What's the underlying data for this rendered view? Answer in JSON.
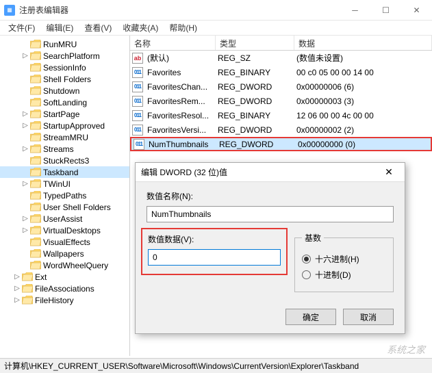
{
  "window": {
    "title": "注册表编辑器"
  },
  "menubar": [
    "文件(F)",
    "编辑(E)",
    "查看(V)",
    "收藏夹(A)",
    "帮助(H)"
  ],
  "tree": {
    "items": [
      "RunMRU",
      "SearchPlatform",
      "SessionInfo",
      "Shell Folders",
      "Shutdown",
      "SoftLanding",
      "StartPage",
      "StartupApproved",
      "StreamMRU",
      "Streams",
      "StuckRects3",
      "Taskband",
      "TWinUI",
      "TypedPaths",
      "User Shell Folders",
      "UserAssist",
      "VirtualDesktops",
      "VisualEffects",
      "Wallpapers",
      "WordWheelQuery",
      "Ext",
      "FileAssociations",
      "FileHistory"
    ],
    "selected": "Taskband",
    "expandable": [
      "SearchPlatform",
      "StartPage",
      "StartupApproved",
      "Streams",
      "TWinUI",
      "UserAssist",
      "VirtualDesktops",
      "Ext",
      "FileAssociations",
      "FileHistory"
    ],
    "indent2": [
      "Ext",
      "FileAssociations",
      "FileHistory"
    ]
  },
  "list": {
    "columns": {
      "name": "名称",
      "type": "类型",
      "data": "数据"
    },
    "rows": [
      {
        "icon": "ab",
        "name": "(默认)",
        "type": "REG_SZ",
        "data": "(数值未设置)"
      },
      {
        "icon": "num",
        "name": "Favorites",
        "type": "REG_BINARY",
        "data": "00 c0 05 00 00 14 00 "
      },
      {
        "icon": "num",
        "name": "FavoritesChan...",
        "type": "REG_DWORD",
        "data": "0x00000006 (6)"
      },
      {
        "icon": "num",
        "name": "FavoritesRem...",
        "type": "REG_DWORD",
        "data": "0x00000003 (3)"
      },
      {
        "icon": "num",
        "name": "FavoritesResol...",
        "type": "REG_BINARY",
        "data": "12 06 00 00 4c 00 00 "
      },
      {
        "icon": "num",
        "name": "FavoritesVersi...",
        "type": "REG_DWORD",
        "data": "0x00000002 (2)"
      },
      {
        "icon": "num",
        "name": "NumThumbnails",
        "type": "REG_DWORD",
        "data": "0x00000000 (0)",
        "highlighted": true,
        "selected": true
      }
    ]
  },
  "dialog": {
    "title": "编辑 DWORD (32 位)值",
    "name_label": "数值名称(N):",
    "name_value": "NumThumbnails",
    "data_label": "数值数据(V):",
    "data_value": "0",
    "base_label": "基数",
    "radio_hex": "十六进制(H)",
    "radio_dec": "十进制(D)",
    "ok": "确定",
    "cancel": "取消"
  },
  "statusbar": {
    "path": "计算机\\HKEY_CURRENT_USER\\Software\\Microsoft\\Windows\\CurrentVersion\\Explorer\\Taskband"
  },
  "watermark": "系统之家"
}
